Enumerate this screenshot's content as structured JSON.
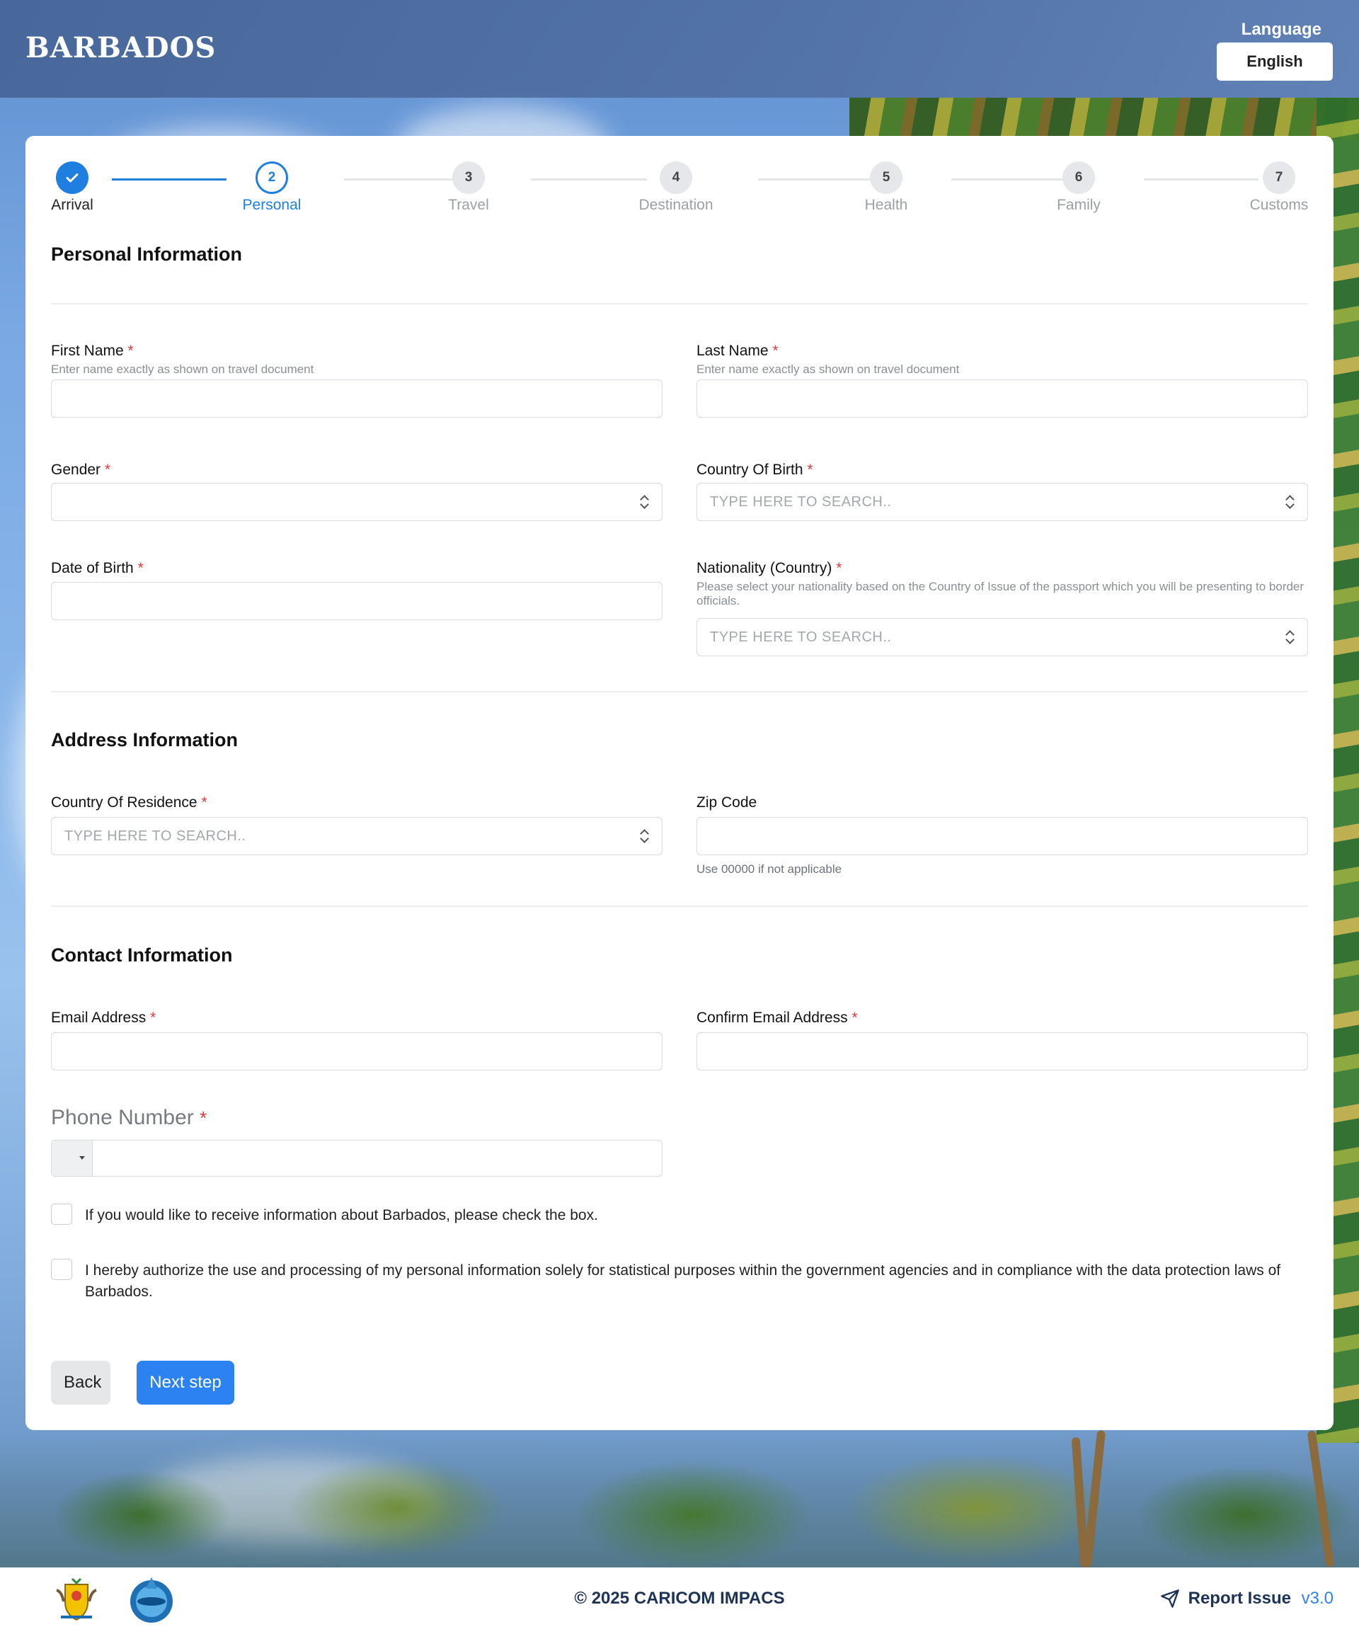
{
  "header": {
    "logo_text": "BARBADOS",
    "language_label": "Language",
    "language_value": "English"
  },
  "stepper": {
    "steps": [
      {
        "number": "",
        "label": "Arrival",
        "state": "done"
      },
      {
        "number": "2",
        "label": "Personal",
        "state": "active"
      },
      {
        "number": "3",
        "label": "Travel",
        "state": "pending"
      },
      {
        "number": "4",
        "label": "Destination",
        "state": "pending"
      },
      {
        "number": "5",
        "label": "Health",
        "state": "pending"
      },
      {
        "number": "6",
        "label": "Family",
        "state": "pending"
      },
      {
        "number": "7",
        "label": "Customs",
        "state": "pending"
      }
    ]
  },
  "personal": {
    "title": "Personal Information",
    "first_name_label": "First Name",
    "first_name_hint": "Enter name exactly as shown on travel document",
    "last_name_label": "Last Name",
    "last_name_hint": "Enter name exactly as shown on travel document",
    "gender_label": "Gender",
    "country_birth_label": "Country Of Birth",
    "country_birth_placeholder": "TYPE HERE TO SEARCH..",
    "dob_label": "Date of Birth",
    "nationality_label": "Nationality (Country)",
    "nationality_hint": "Please select your nationality based on the Country of Issue of the passport which you will be presenting to border officials.",
    "nationality_placeholder": "TYPE HERE TO SEARCH.."
  },
  "address": {
    "title": "Address Information",
    "residence_label": "Country Of Residence",
    "residence_placeholder": "TYPE HERE TO SEARCH..",
    "zip_label": "Zip Code",
    "zip_hint": "Use 00000 if not applicable"
  },
  "contact": {
    "title": "Contact Information",
    "email_label": "Email Address",
    "confirm_email_label": "Confirm Email Address",
    "phone_label": "Phone Number",
    "required_mark": "*"
  },
  "consent": {
    "info_text": "If you would like to receive information about Barbados, please check the box.",
    "authorize_text": "I hereby authorize the use and processing of my personal information solely for statistical purposes within the government agencies and in compliance with the data protection laws of Barbados."
  },
  "actions": {
    "back_label": "Back",
    "next_label": "Next step"
  },
  "footer": {
    "copyright": "© 2025 CARICOM IMPACS",
    "report_label": "Report Issue",
    "version": "v3.0"
  },
  "colors": {
    "accent": "#2b82f0",
    "required": "#e03a3a",
    "footer_text": "#1d3355"
  }
}
